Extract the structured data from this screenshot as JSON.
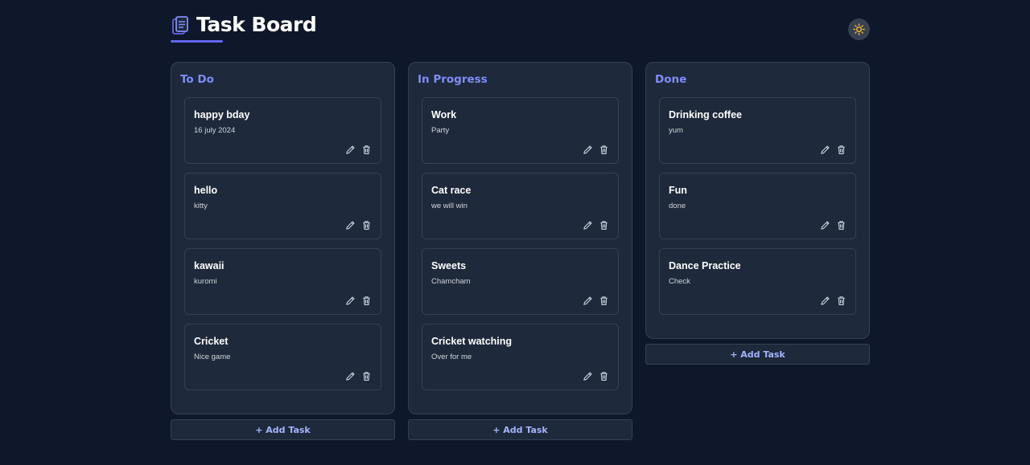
{
  "header": {
    "title": "Task Board",
    "accent_color": "#6366f1",
    "theme_toggle_icon": "sun-icon"
  },
  "columns": [
    {
      "title": "To Do",
      "add_task_label": "+ Add Task",
      "cards": [
        {
          "title": "happy bday",
          "description": "16 july 2024"
        },
        {
          "title": "hello",
          "description": "kitty"
        },
        {
          "title": "kawaii",
          "description": "kuromi"
        },
        {
          "title": "Cricket",
          "description": "Nice game"
        }
      ]
    },
    {
      "title": "In Progress",
      "add_task_label": "+ Add Task",
      "cards": [
        {
          "title": "Work",
          "description": "Party"
        },
        {
          "title": "Cat race",
          "description": "we will win"
        },
        {
          "title": "Sweets",
          "description": "Chamcham"
        },
        {
          "title": "Cricket watching",
          "description": "Over for me"
        }
      ]
    },
    {
      "title": "Done",
      "add_task_label": "+ Add Task",
      "cards": [
        {
          "title": "Drinking coffee",
          "description": "yum"
        },
        {
          "title": "Fun",
          "description": "done"
        },
        {
          "title": "Dance Practice",
          "description": "Check"
        }
      ]
    }
  ],
  "icons": {
    "edit": "pencil-icon",
    "delete": "trash-icon"
  }
}
